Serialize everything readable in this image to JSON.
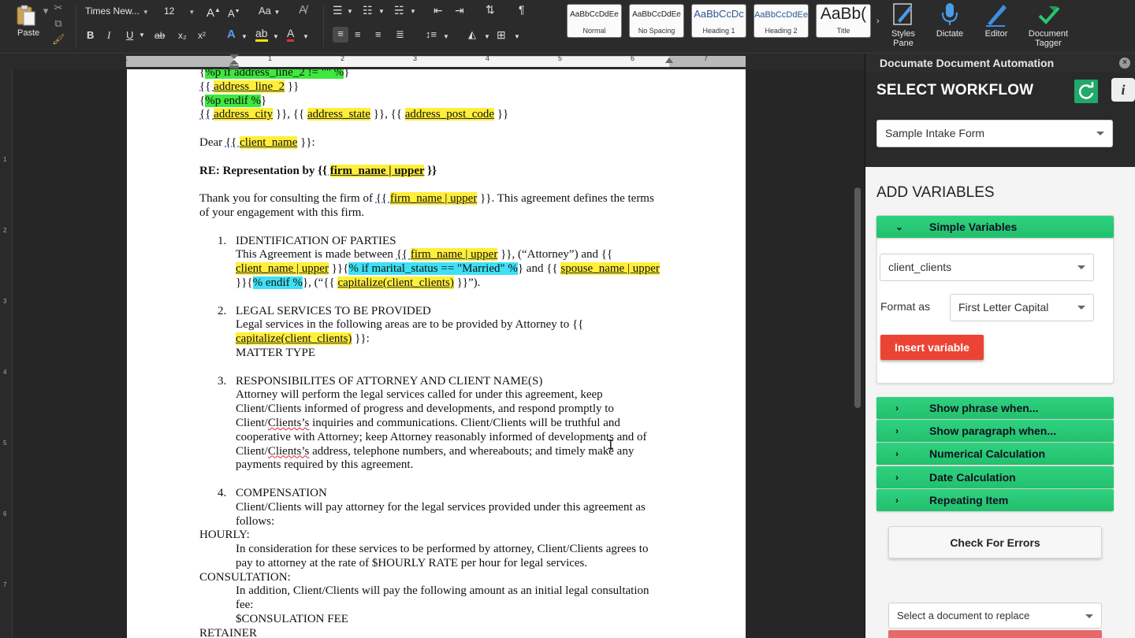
{
  "ribbon": {
    "paste_label": "Paste",
    "font_name": "Times New...",
    "font_size": "12",
    "grow_font": "A",
    "shrink_font": "A",
    "change_case": "Aa",
    "bold": "B",
    "italic": "I",
    "underline": "U",
    "strike": "ab",
    "subscript": "x₂",
    "superscript": "x²",
    "paragraph_mark": "¶",
    "styles": [
      {
        "sample": "AaBbCcDdEe",
        "name": "Normal"
      },
      {
        "sample": "AaBbCcDdEe",
        "name": "No Spacing"
      },
      {
        "sample": "AaBbCcDc",
        "name": "Heading 1"
      },
      {
        "sample": "AaBbCcDdEe",
        "name": "Heading 2"
      },
      {
        "sample": "AaBb(",
        "name": "Title"
      }
    ],
    "tools": [
      {
        "label": "Styles\nPane",
        "icon": "styles-pane-icon"
      },
      {
        "label": "Dictate",
        "icon": "microphone-icon"
      },
      {
        "label": "Editor",
        "icon": "editor-pen-icon"
      },
      {
        "label": "Document\nTagger",
        "icon": "tagger-icon"
      }
    ],
    "accent_color": "#1f6fd1"
  },
  "ruler": {
    "numbers": [
      "1",
      "2",
      "3",
      "4",
      "5",
      "6",
      "7"
    ],
    "vertical_numbers": [
      "1",
      "2",
      "3",
      "4",
      "5",
      "6",
      "7"
    ]
  },
  "document": {
    "line1_pre": "{",
    "line1_hl": "%p if address_line_2 != \"\" %",
    "line1_post": "}",
    "line2_pre": "{{ ",
    "line2_hl": "address_line_2",
    "line2_post": " }}",
    "line3_pre": "{",
    "line3_hl": "%p endif %",
    "line3_post": "}",
    "line4_a": "{{ ",
    "line4_b": "address_city",
    "line4_c": " }}, {{ ",
    "line4_d": "address_state",
    "line4_e": " }}, {{ ",
    "line4_f": "address_post_code",
    "line4_g": " }}",
    "dear_pre": "Dear ",
    "dear_brace_open": "{{ ",
    "dear_var": "client_name",
    "dear_post": " }}:",
    "re_pre": "RE: Representation by ",
    "re_brace_open": "{{ ",
    "re_var": "firm_name | upper",
    "re_post": " }}",
    "thank_pre": "Thank you for consulting the firm of ",
    "thank_brace_open": "{{ ",
    "thank_var": "firm_name | upper",
    "thank_post": " }}. This agreement defines the terms",
    "thank_line2": "of your engagement with this firm.",
    "s1_num": "1.",
    "s1_title": "IDENTIFICATION OF PARTIES",
    "s1_l1_pre": "This Agreement is made between ",
    "s1_l1_brace": "{{ ",
    "s1_l1_var": "firm_name | upper",
    "s1_l1_post": " }}, (“Attorney”) and {{",
    "s1_l2_var": "client_name | upper",
    "s1_l2_mid": " }}{",
    "s1_l2_cond": "% if marital_status == \"Married\" %",
    "s1_l2_mid2": "} and {{ ",
    "s1_l2_var2": "spouse_name | upper",
    "s1_l3_pre": "}}{",
    "s1_l3_cond": "% endif %",
    "s1_l3_mid": "}, (“{{ ",
    "s1_l3_var": "capitalize(client_clients)",
    "s1_l3_post": " }}”).",
    "s2_num": "2.",
    "s2_title": "LEGAL SERVICES TO BE PROVIDED",
    "s2_l1": "Legal services in the following areas are to be provided by Attorney to {{",
    "s2_l2_var": "capitalize(client_clients)",
    "s2_l2_post": " }}:",
    "s2_l3": "MATTER TYPE",
    "s3_num": "3.",
    "s3_title": "RESPONSIBILITES OF ATTORNEY AND CLIENT NAME(S)",
    "s3_l1": "Attorney will perform the legal services called for under this agreement, keep",
    "s3_l2": "Client/Clients informed of progress and developments, and respond promptly to",
    "s3_l3_a": "Client/",
    "s3_l3_sq": "Clients’s",
    "s3_l3_b": " inquiries and communications. Client/Clients will be truthful and",
    "s3_l4": "cooperative with Attorney; keep Attorney reasonably informed of developments and of",
    "s3_l5_a": "Client/",
    "s3_l5_sq": "Clients’s",
    "s3_l5_b": " address, telephone numbers, and whereabouts; and timely make any",
    "s3_l6": "payments required by this agreement.",
    "s4_num": "4.",
    "s4_title": "COMPENSATION",
    "s4_l1": "Client/Clients will pay attorney for the legal services provided under this agreement as",
    "s4_l2": "follows:",
    "hourly": "HOURLY:",
    "hourly_l1": "In consideration for these services to be performed by attorney, Client/Clients agrees to",
    "hourly_l2": "pay to attorney at the rate of $HOURLY RATE per hour for legal services.",
    "consult": "CONSULTATION:",
    "consult_l1": "In addition, Client/Clients will pay the following amount as an initial legal consultation",
    "consult_l2": "fee:",
    "consult_l3": "$CONSULATION FEE",
    "retainer": "RETAINER"
  },
  "panel": {
    "title": "Documate Document Automation",
    "close": "×",
    "select_workflow": "SELECT WORKFLOW",
    "info": "i",
    "workflow_value": "Sample Intake Form",
    "add_variables": "ADD VARIABLES",
    "simple_variables": "Simple Variables",
    "variable_value": "client_clients",
    "format_label": "Format as",
    "format_value": "First Letter Capital",
    "insert_variable": "Insert variable",
    "accordions": [
      "Show phrase when...",
      "Show paragraph when...",
      "Numerical Calculation",
      "Date Calculation",
      "Repeating Item"
    ],
    "check_errors": "Check For Errors",
    "replace_placeholder": "Select a document to replace",
    "green": "#27c873",
    "red": "#ec4434"
  }
}
